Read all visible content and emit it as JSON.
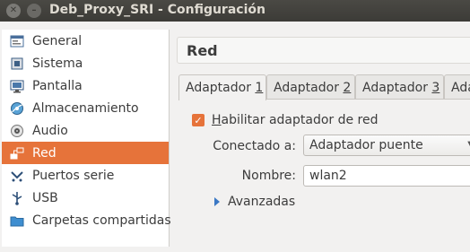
{
  "window": {
    "title": "Deb_Proxy_SRI - Configuración"
  },
  "sidebar": {
    "items": [
      {
        "label": "General",
        "icon": "general-icon"
      },
      {
        "label": "Sistema",
        "icon": "system-icon"
      },
      {
        "label": "Pantalla",
        "icon": "display-icon"
      },
      {
        "label": "Almacenamiento",
        "icon": "storage-icon"
      },
      {
        "label": "Audio",
        "icon": "audio-icon"
      },
      {
        "label": "Red",
        "icon": "network-icon",
        "selected": true
      },
      {
        "label": "Puertos serie",
        "icon": "serial-ports-icon"
      },
      {
        "label": "USB",
        "icon": "usb-icon"
      },
      {
        "label": "Carpetas compartidas",
        "icon": "shared-folders-icon"
      }
    ]
  },
  "main": {
    "title": "Red",
    "tabs": [
      {
        "label_prefix": "Adaptador ",
        "label_num": "1",
        "active": true
      },
      {
        "label_prefix": "Adaptador ",
        "label_num": "2"
      },
      {
        "label_prefix": "Adaptador ",
        "label_num": "3"
      },
      {
        "label_prefix": "Ada",
        "label_num": ""
      }
    ],
    "enable_checkbox": {
      "label_first": "H",
      "label_rest": "abilitar adaptador de red",
      "checked": true
    },
    "attached_to": {
      "label": "Conectado a:",
      "value": "Adaptador puente"
    },
    "name": {
      "label": "Nombre:",
      "value": "wlan2"
    },
    "advanced": {
      "label": "Avanzadas"
    }
  },
  "colors": {
    "accent": "#e6733a",
    "titlebar": "#3c3b37"
  }
}
